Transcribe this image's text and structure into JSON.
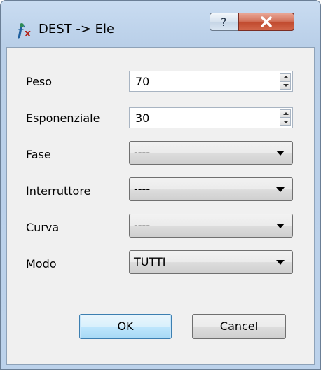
{
  "window": {
    "title": "DEST -> Ele",
    "icon": "function-icon",
    "help_glyph": "?",
    "close_glyph": "X"
  },
  "form": {
    "fields": [
      {
        "label": "Peso",
        "type": "spinbox",
        "value": "70"
      },
      {
        "label": "Esponenziale",
        "type": "spinbox",
        "value": "30"
      },
      {
        "label": "Fase",
        "type": "combobox",
        "value": "----"
      },
      {
        "label": "Interruttore",
        "type": "combobox",
        "value": "----"
      },
      {
        "label": "Curva",
        "type": "combobox",
        "value": "----"
      },
      {
        "label": "Modo",
        "type": "combobox",
        "value": "TUTTI"
      }
    ]
  },
  "buttons": {
    "ok": "OK",
    "cancel": "Cancel"
  },
  "colors": {
    "titlebar": "#c9dcf1",
    "close_button": "#c7543a",
    "dialog_background": "#f0f0f0",
    "ok_border": "#3c7fb1"
  }
}
